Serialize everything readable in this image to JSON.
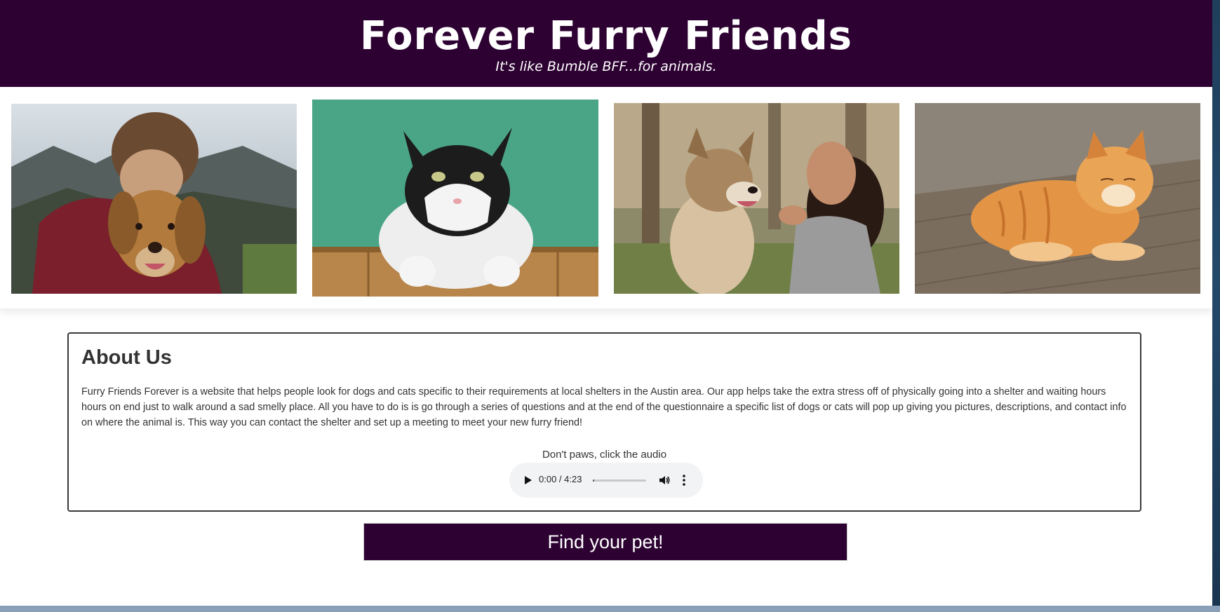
{
  "header": {
    "title": "Forever Furry Friends",
    "tagline": "It's like Bumble BFF...for animals."
  },
  "gallery": {
    "photos": [
      {
        "icon": "man-hugging-golden-retriever-photo"
      },
      {
        "icon": "black-white-cat-photo"
      },
      {
        "icon": "woman-with-dog-photo"
      },
      {
        "icon": "orange-tabby-cat-photo"
      }
    ]
  },
  "about": {
    "heading": "About Us",
    "body": "Furry Friends Forever is a website that helps people look for dogs and cats specific to their requirements at local shelters in the Austin area. Our app helps take the extra stress off of physically going into a shelter and waiting hours hours on end just to walk around a sad smelly place. All you have to do is is go through a series of questions and at the end of the questionnaire a specific list of dogs or cats will pop up giving you pictures, descriptions, and contact info on where the animal is. This way you can contact the shelter and set up a meeting to meet your new furry friend!",
    "audio_caption": "Don't paws, click the audio",
    "audio": {
      "time": "0:00 / 4:23",
      "progress": 0.0
    }
  },
  "cta": {
    "label": "Find your pet!"
  },
  "colors": {
    "brand": "#2d0232",
    "background": "#ffffff",
    "text": "#333333"
  }
}
